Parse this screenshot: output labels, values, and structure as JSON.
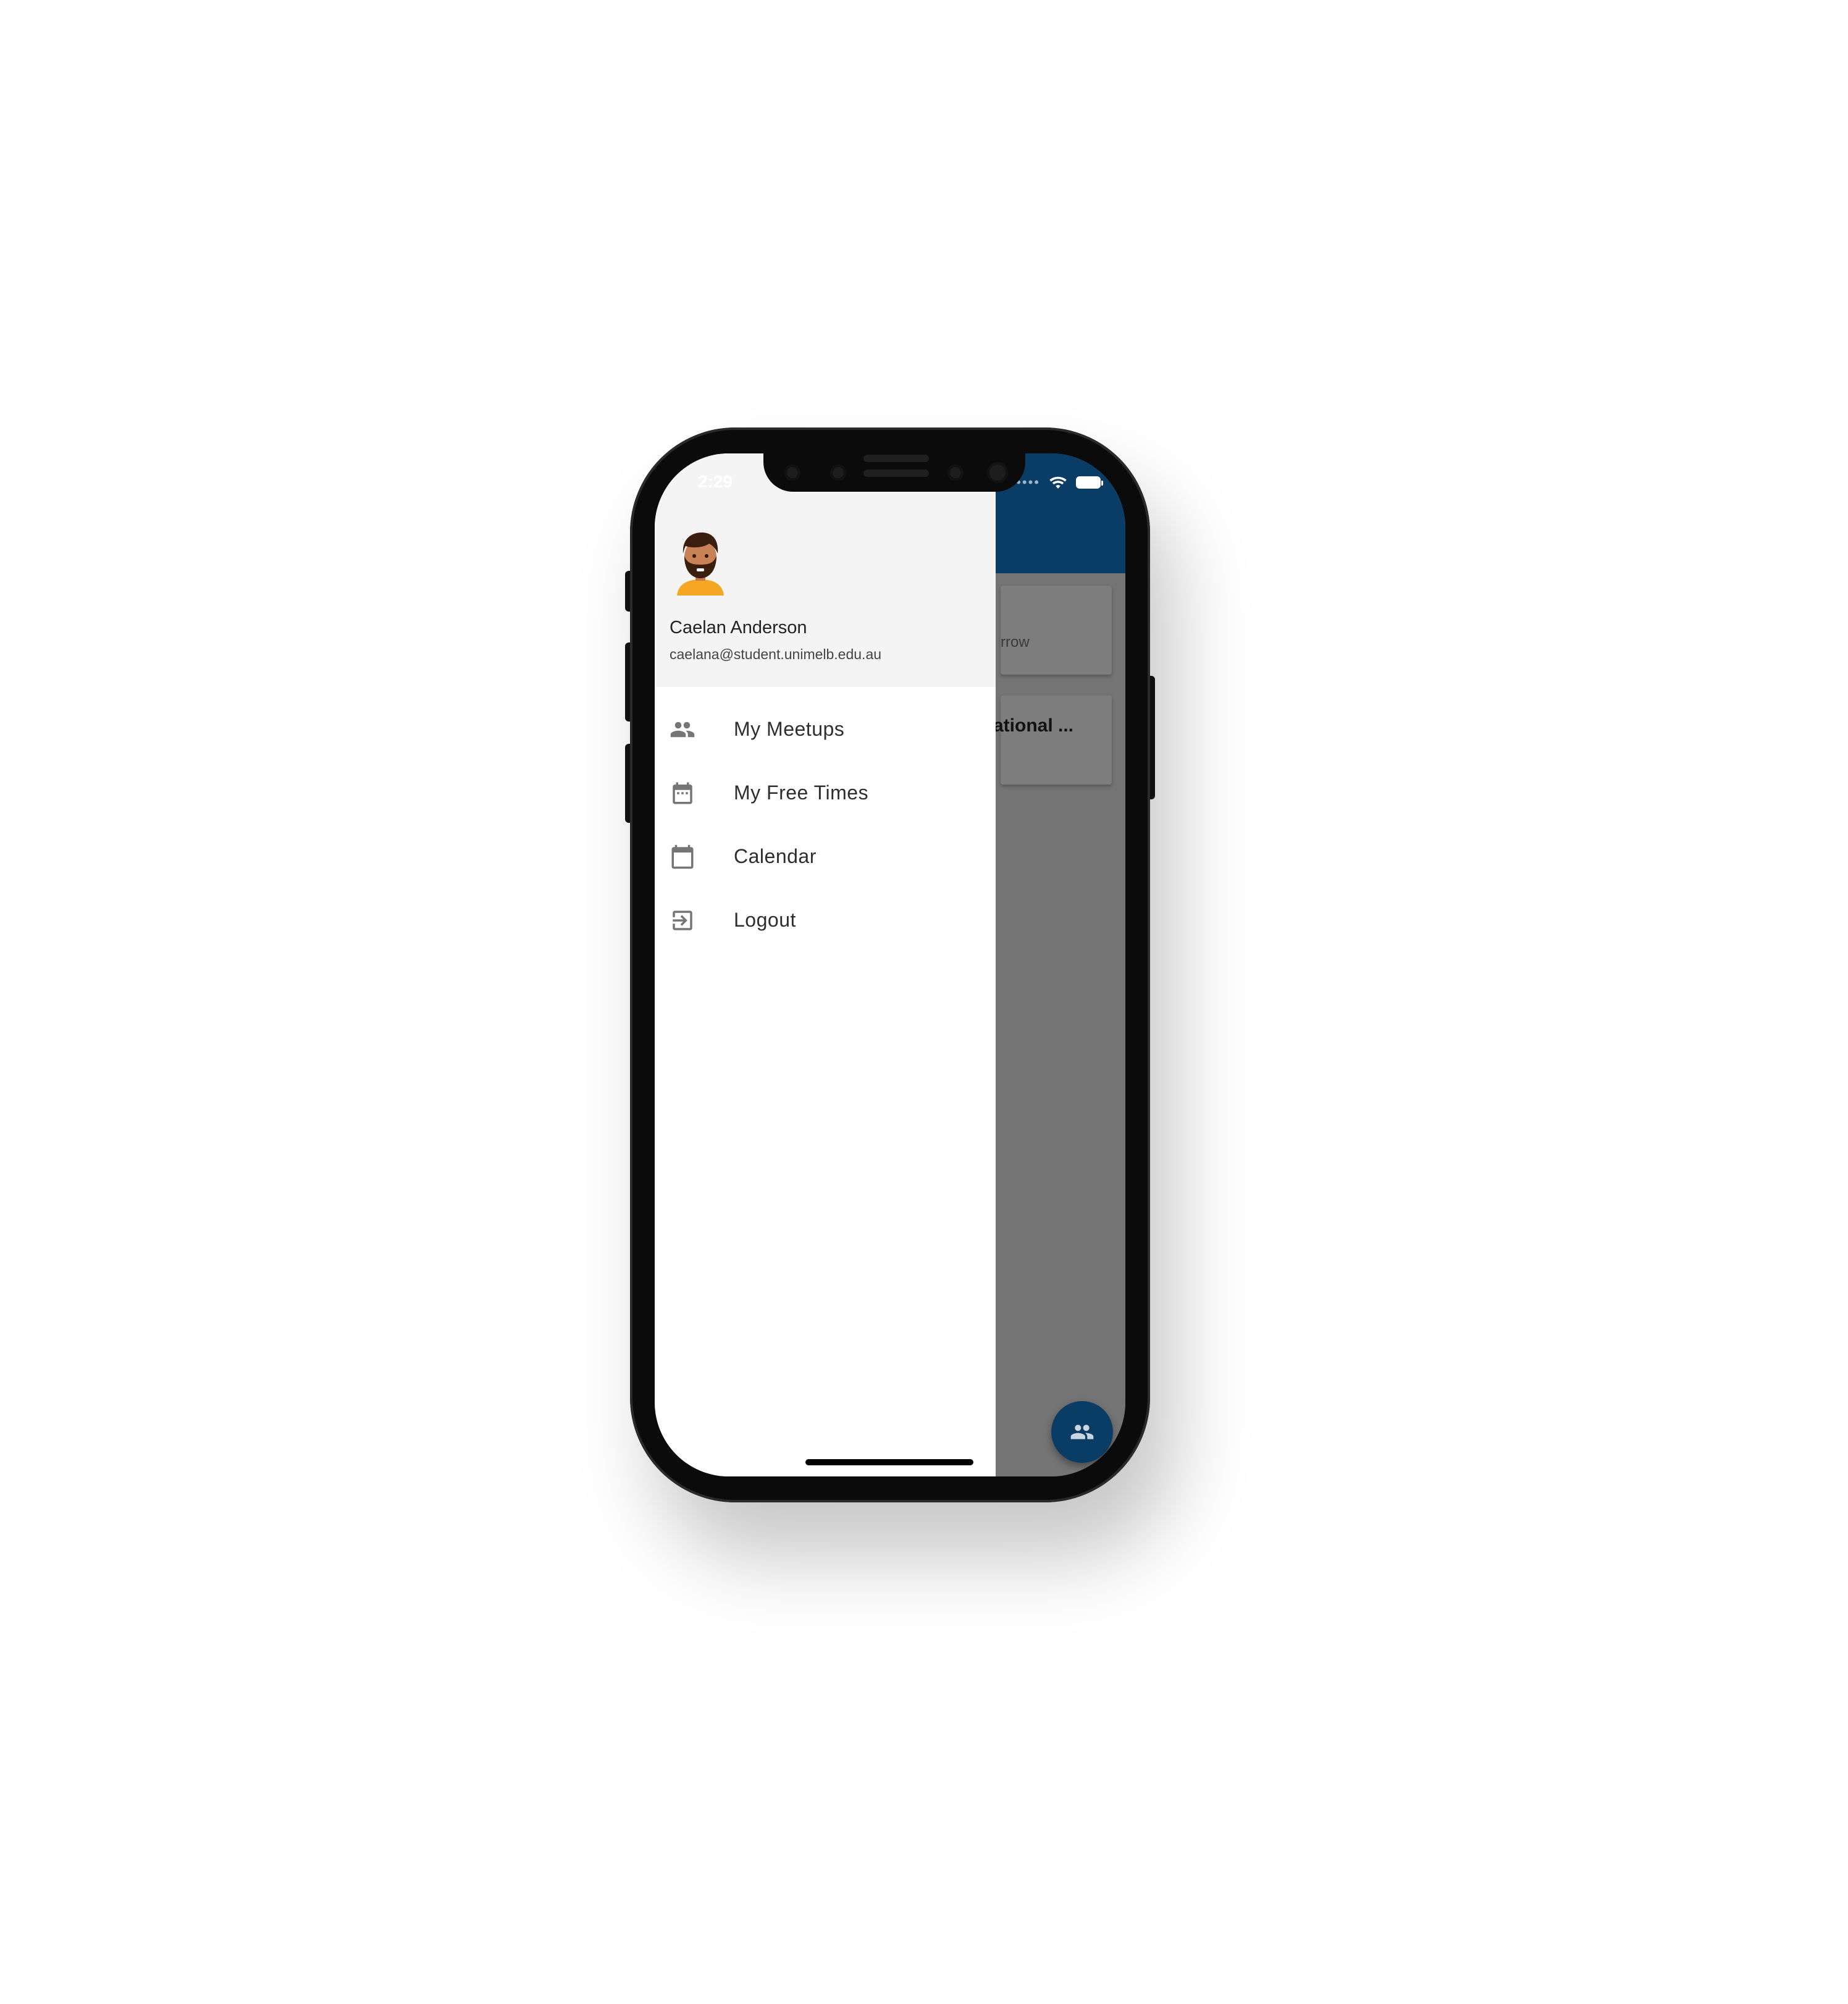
{
  "status_bar": {
    "time": "2:29"
  },
  "drawer": {
    "user": {
      "name": "Caelan Anderson",
      "email": "caelana@student.unimelb.edu.au"
    },
    "items": [
      {
        "label": "My Meetups",
        "icon": "people-icon"
      },
      {
        "label": "My Free Times",
        "icon": "event-calendar-icon"
      },
      {
        "label": "Calendar",
        "icon": "calendar-icon"
      },
      {
        "label": "Logout",
        "icon": "logout-icon"
      }
    ]
  },
  "background_app": {
    "card1_subtitle": "rrow",
    "card2_title": "ational ...",
    "fab_icon": "people-icon"
  },
  "colors": {
    "app_bar": "#0a3d66",
    "drawer_header": "#f4f4f4",
    "icon": "#757575"
  }
}
